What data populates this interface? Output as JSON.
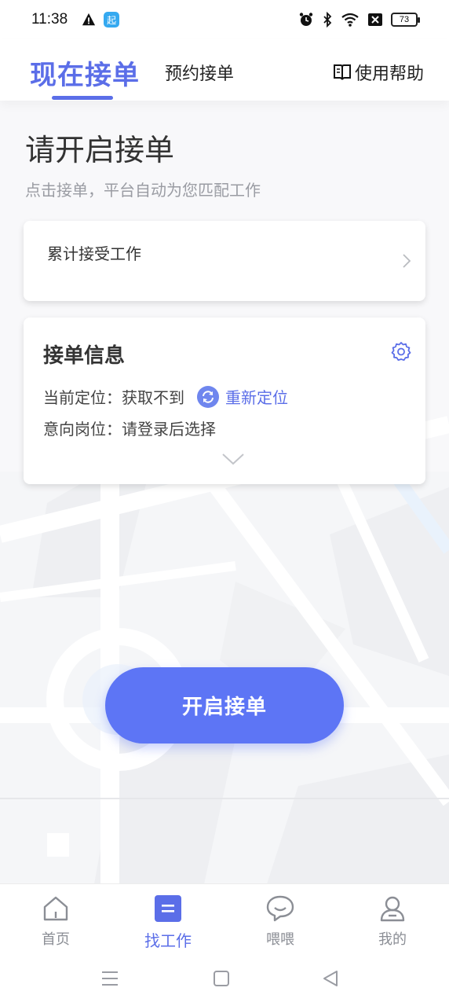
{
  "status_bar": {
    "time": "11:38",
    "app_badge": "起",
    "battery": "73",
    "icons": [
      "warning-icon",
      "app-badge-icon",
      "alarm-icon",
      "bluetooth-icon",
      "wifi-icon",
      "sim-off-icon",
      "battery-icon"
    ]
  },
  "header": {
    "active_tab": "现在接单",
    "inactive_tab": "预约接单",
    "help_label": "使用帮助"
  },
  "main": {
    "title": "请开启接单",
    "subtitle": "点击接单，平台自动为您匹配工作"
  },
  "total_card": {
    "label": "累计接受工作"
  },
  "info_card": {
    "title": "接单信息",
    "location_label": "当前定位：",
    "location_value": "获取不到",
    "relocate_label": "重新定位",
    "job_label": "意向岗位：",
    "job_value": "请登录后选择"
  },
  "start_button": {
    "label": "开启接单"
  },
  "bottom_nav": {
    "items": [
      {
        "label": "首页",
        "icon": "home-icon"
      },
      {
        "label": "找工作",
        "icon": "jobs-icon",
        "active": true
      },
      {
        "label": "喂喂",
        "icon": "chat-icon"
      },
      {
        "label": "我的",
        "icon": "profile-icon"
      }
    ]
  },
  "colors": {
    "accent": "#5b6ee8",
    "button": "#5d75f5",
    "text": "#333333",
    "muted": "#9a9ca3"
  }
}
